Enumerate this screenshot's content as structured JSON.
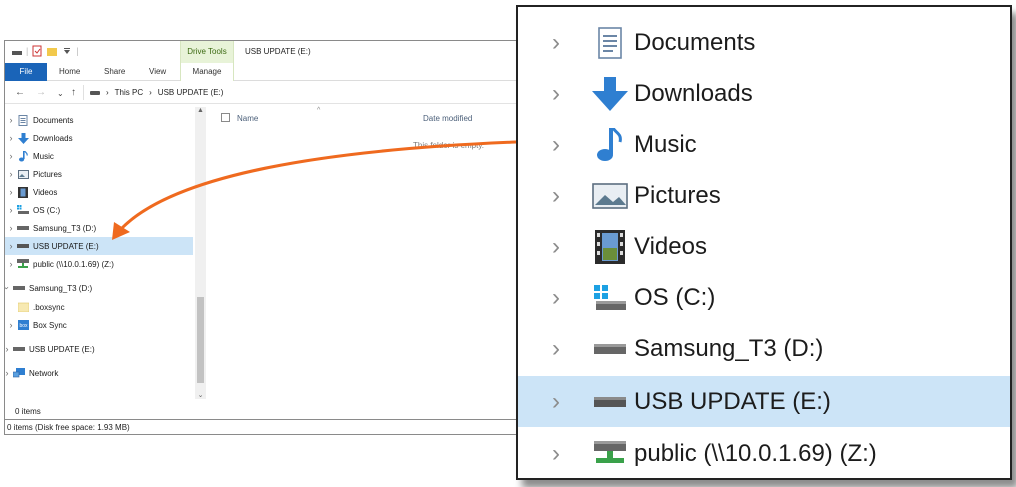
{
  "colors": {
    "file_tab": "#1a64b8",
    "drive_tools_bg": "#e8f3d8",
    "selection": "#cce4f7",
    "arrow": "#ef6a1f"
  },
  "window": {
    "title": "USB UPDATE (E:)",
    "contextual_tab": "Drive Tools",
    "ribbon_tabs": {
      "file": "File",
      "home": "Home",
      "share": "Share",
      "view": "View",
      "manage": "Manage"
    },
    "address": {
      "this_pc": "This PC",
      "sep": "›",
      "drive": "USB UPDATE (E:)"
    },
    "nav_items": [
      {
        "label": "Documents",
        "icon": "documents-icon"
      },
      {
        "label": "Downloads",
        "icon": "downloads-icon"
      },
      {
        "label": "Music",
        "icon": "music-icon"
      },
      {
        "label": "Pictures",
        "icon": "pictures-icon"
      },
      {
        "label": "Videos",
        "icon": "videos-icon"
      },
      {
        "label": "OS (C:)",
        "icon": "os-drive-icon"
      },
      {
        "label": "Samsung_T3 (D:)",
        "icon": "drive-icon"
      },
      {
        "label": "USB UPDATE (E:)",
        "icon": "drive-icon",
        "selected": true
      },
      {
        "label": "public (\\\\10.0.1.69) (Z:)",
        "icon": "network-drive-icon"
      },
      {
        "label": "Samsung_T3 (D:)",
        "icon": "drive-icon",
        "expanded": true
      },
      {
        "label": ".boxsync",
        "icon": "folder-icon"
      },
      {
        "label": "Box Sync",
        "icon": "box-sync-icon"
      },
      {
        "label": "USB UPDATE (E:)",
        "icon": "drive-icon"
      },
      {
        "label": "Network",
        "icon": "network-icon"
      }
    ],
    "columns": {
      "name": "Name",
      "date_modified": "Date modified"
    },
    "empty_message": "This folder is empty.",
    "status_items": "0 items",
    "status_detail": "0 items (Disk free space: 1.93 MB)"
  },
  "zoom": {
    "items": [
      {
        "label": "Documents",
        "icon": "documents-icon"
      },
      {
        "label": "Downloads",
        "icon": "downloads-icon"
      },
      {
        "label": "Music",
        "icon": "music-icon"
      },
      {
        "label": "Pictures",
        "icon": "pictures-icon"
      },
      {
        "label": "Videos",
        "icon": "videos-icon"
      },
      {
        "label": "OS (C:)",
        "icon": "os-drive-icon"
      },
      {
        "label": "Samsung_T3 (D:)",
        "icon": "drive-icon"
      },
      {
        "label": "USB UPDATE (E:)",
        "icon": "drive-icon",
        "selected": true
      },
      {
        "label": "public (\\\\10.0.1.69) (Z:)",
        "icon": "network-drive-icon"
      }
    ]
  }
}
